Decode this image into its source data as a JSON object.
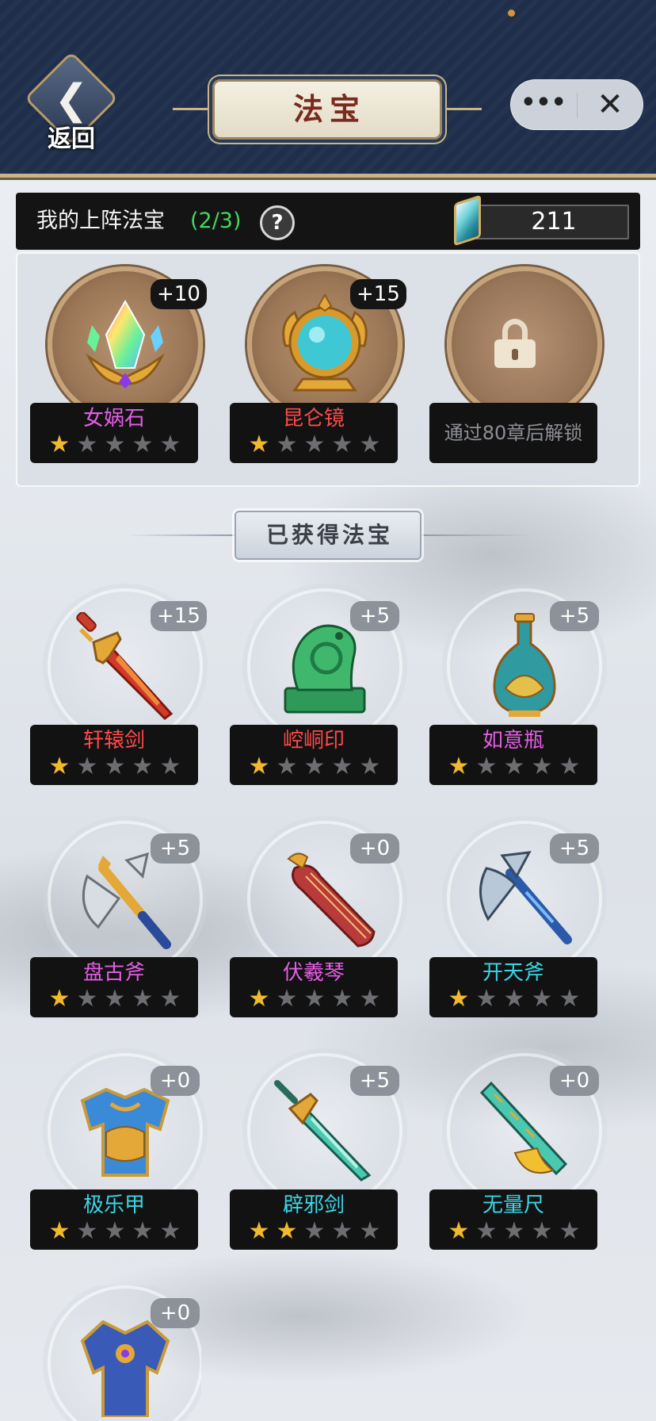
{
  "header": {
    "back_label": "返回",
    "title": "法宝",
    "more_label": "•••",
    "close_label": "✕"
  },
  "my_equipped": {
    "label": "我的上阵法宝",
    "count": "(2/3)",
    "help_label": "?",
    "currency_icon": "crystal-gem-icon",
    "currency_value": "211"
  },
  "equipped_slots": [
    {
      "name": "女娲石",
      "level": "+10",
      "stars": 1,
      "max_stars": 5,
      "name_color": "#e45ee6",
      "icon": "rainbow-crystal-crown-icon"
    },
    {
      "name": "昆仑镜",
      "level": "+15",
      "stars": 1,
      "max_stars": 5,
      "name_color": "#ff4a4a",
      "icon": "golden-mirror-icon"
    },
    {
      "locked": true,
      "unlock_text": "通过80章后解锁",
      "icon": "lock-icon"
    }
  ],
  "section_title": "已获得法宝",
  "owned_items": [
    {
      "name": "轩辕剑",
      "level": "+15",
      "stars": 1,
      "name_color": "#ff4a4a",
      "icon": "flame-sword-icon"
    },
    {
      "name": "崆峒印",
      "level": "+5",
      "stars": 1,
      "name_color": "#ff4a4a",
      "icon": "jade-seal-icon"
    },
    {
      "name": "如意瓶",
      "level": "+5",
      "stars": 1,
      "name_color": "#e45ee6",
      "icon": "vase-icon"
    },
    {
      "name": "盘古斧",
      "level": "+5",
      "stars": 1,
      "name_color": "#e45ee6",
      "icon": "golden-axe-icon"
    },
    {
      "name": "伏羲琴",
      "level": "+0",
      "stars": 1,
      "name_color": "#e45ee6",
      "icon": "guqin-icon"
    },
    {
      "name": "开天斧",
      "level": "+5",
      "stars": 1,
      "name_color": "#3ad6e6",
      "icon": "steel-axe-icon"
    },
    {
      "name": "极乐甲",
      "level": "+0",
      "stars": 1,
      "name_color": "#3ad6e6",
      "icon": "armor-icon"
    },
    {
      "name": "辟邪剑",
      "level": "+5",
      "stars": 2,
      "name_color": "#3ad6e6",
      "icon": "teal-sword-icon"
    },
    {
      "name": "无量尺",
      "level": "+0",
      "stars": 1,
      "name_color": "#3ad6e6",
      "icon": "jade-ruler-icon"
    },
    {
      "name": "",
      "level": "+0",
      "stars": 0,
      "name_color": "#3ad6e6",
      "icon": "blue-armor-icon"
    }
  ],
  "colors": {
    "header_bg": "#1f2f4b",
    "gold_trim": "#c9b48a",
    "star_on": "#f2b92e",
    "star_off": "#6c6e72",
    "count_green": "#3fd95b"
  }
}
